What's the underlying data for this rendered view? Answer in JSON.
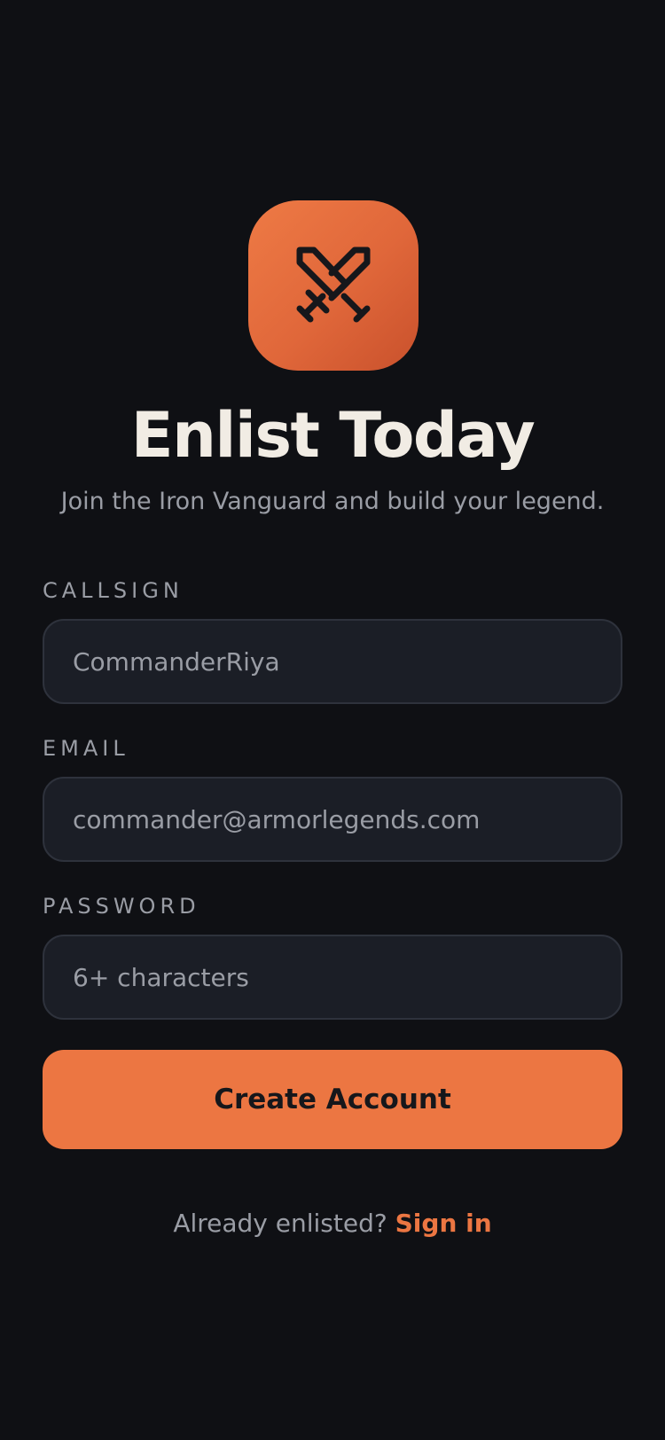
{
  "header": {
    "app_icon_name": "crossed-swords-icon",
    "title": "Enlist Today",
    "subtitle": "Join the Iron Vanguard and build your legend."
  },
  "form": {
    "callsign": {
      "label": "CALLSIGN",
      "placeholder": "CommanderRiya"
    },
    "email": {
      "label": "EMAIL",
      "placeholder": "commander@armorlegends.com"
    },
    "password": {
      "label": "PASSWORD",
      "placeholder": "6+ characters"
    },
    "submit_label": "Create Account"
  },
  "footer": {
    "prompt": "Already enlisted?",
    "signin_label": "Sign in"
  },
  "colors": {
    "background": "#0f1014",
    "accent": "#ec7642",
    "field_background": "#1b1e26",
    "field_border": "#2e323c",
    "title_text": "#f1ece4",
    "muted_text": "#9a9da5"
  }
}
